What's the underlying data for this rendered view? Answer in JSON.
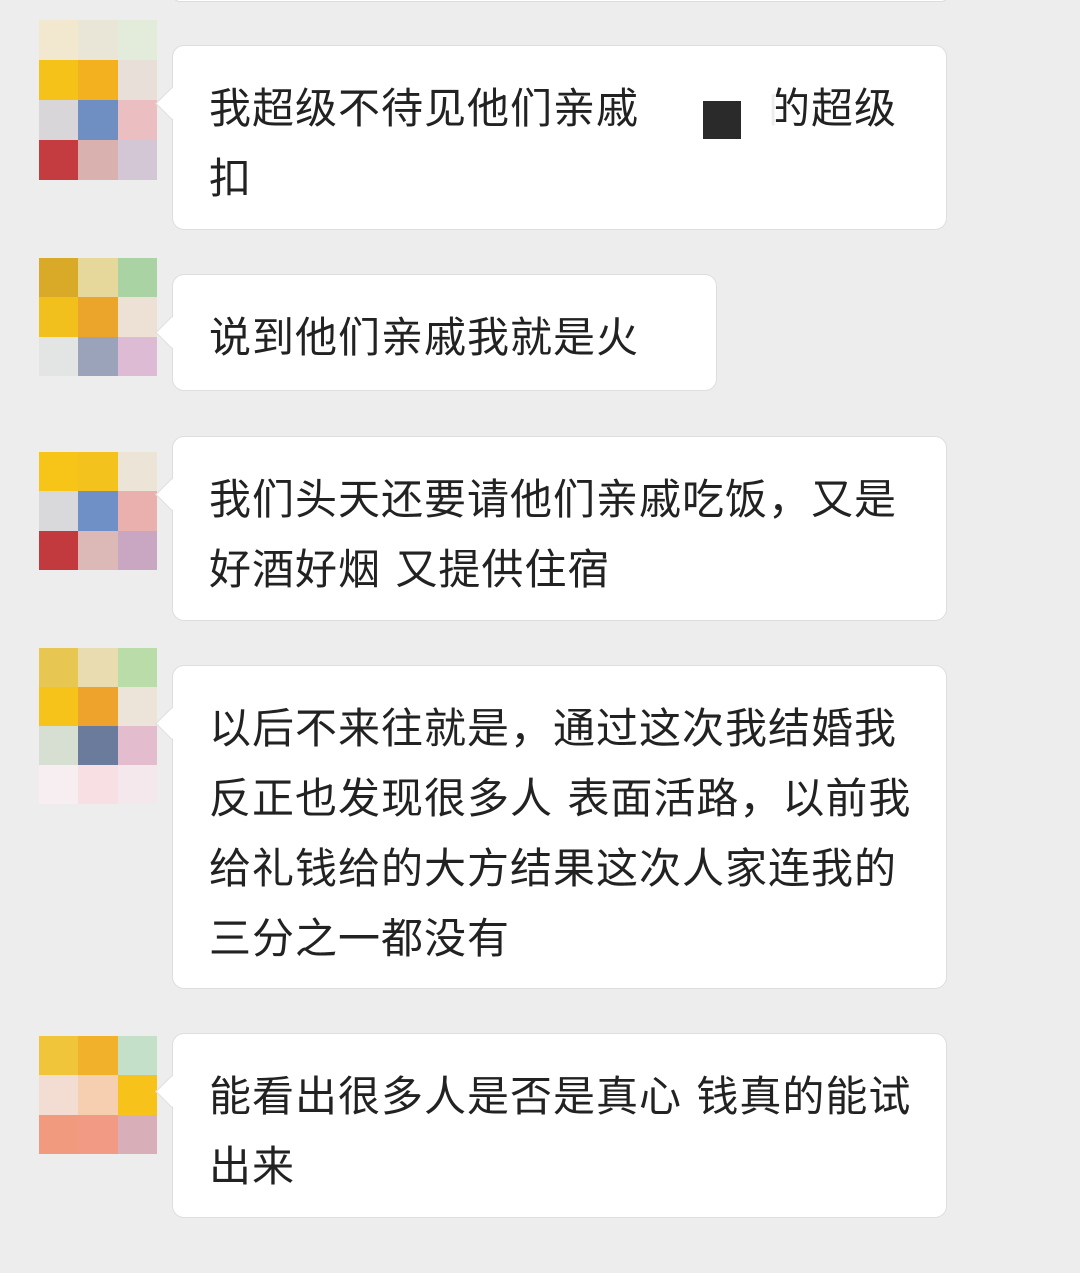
{
  "colors": {
    "background": "#ededed",
    "bubble": "#ffffff",
    "bubble_border": "#dedede",
    "text": "#222222"
  },
  "messages": [
    {
      "text": "我超级不待见他们亲戚　　　的超级扣",
      "avatar_pixels": [
        "#f1e8cf",
        "#e9e6d8",
        "#dfe9d3",
        "#f5c21a",
        "#f3b01f",
        "#e6d9d2",
        "#d8d6d8",
        "#6f8fc3",
        "#e9aeb3",
        "#c43b40",
        "#d9b2b0",
        "#c9b9cc"
      ]
    },
    {
      "text": "说到他们亲戚我就是火",
      "avatar_pixels": [
        "#d9a928",
        "#e6d89a",
        "#a9d3a2",
        "#f2c01c",
        "#eca52b",
        "#ece1d4",
        "#e3e4e4",
        "#9aa3b9",
        "#ddbbd4"
      ]
    },
    {
      "text": "我们头天还要请他们亲戚吃饭，又是好酒好烟 又提供住宿",
      "avatar_pixels": [
        "#f6c518",
        "#f3c21c",
        "#ece5d7",
        "#d9d8da",
        "#6e90c6",
        "#eab0ad",
        "#c23a3e",
        "#dcb9b6",
        "#c9a7c2"
      ]
    },
    {
      "text": "以后不来往就是，通过这次我结婚我反正也发现很多人 表面活路，以前我给礼钱给的大方结果这次人家连我的三分之一都没有",
      "avatar_pixels": [
        "#e7c752",
        "#e9dcb0",
        "#b9dca9",
        "#f6c31b",
        "#eda32c",
        "#ece4d8",
        "#d7dfd3",
        "#6b7b9c",
        "#e3bccd",
        "#f6eef0",
        "#f7dfe4",
        "#f4e8ec"
      ]
    },
    {
      "text": "能看出很多人是否是真心 钱真的能试出来",
      "avatar_pixels": [
        "#f0c53a",
        "#f2b12a",
        "#c4e0c8",
        "#f3ddd2",
        "#f6cfb0",
        "#f7c21a",
        "#f19a7e",
        "#f39a84",
        "#d8aeb8"
      ]
    }
  ]
}
